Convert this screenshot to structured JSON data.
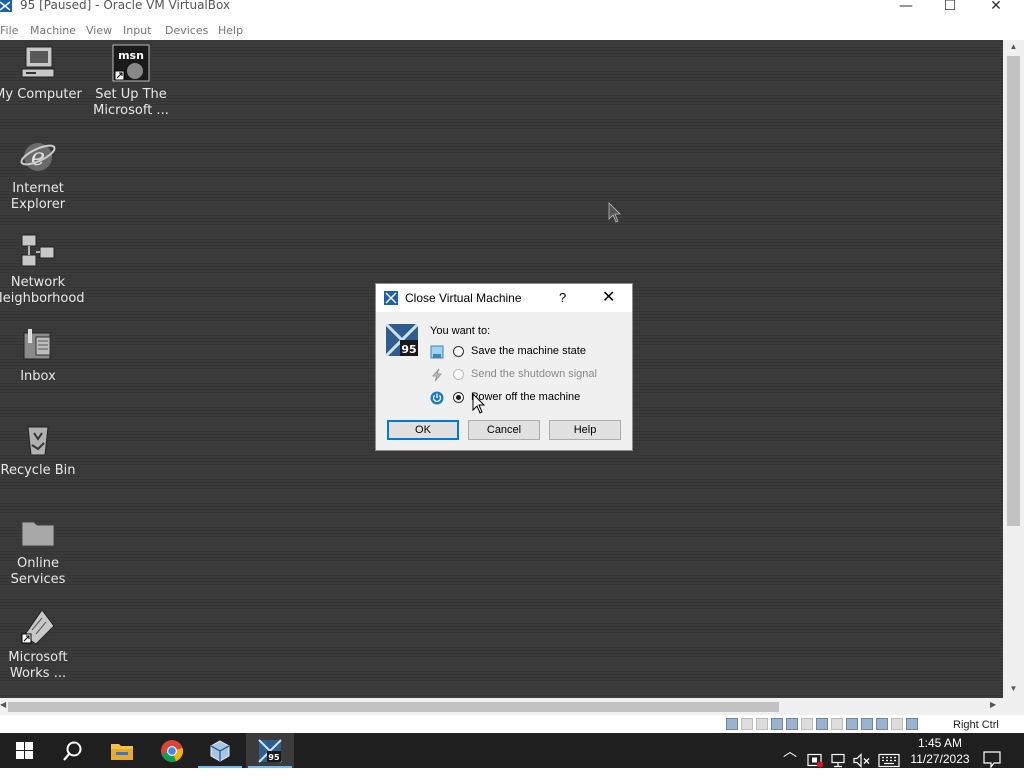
{
  "window": {
    "title": "95 [Paused] - Oracle VM VirtualBox",
    "minimize": "—",
    "maximize": "☐",
    "close": "✕"
  },
  "menu": [
    "File",
    "Machine",
    "View",
    "Input",
    "Devices",
    "Help"
  ],
  "desktop_icons": [
    {
      "line1": "My Computer",
      "line2": "",
      "icon": "computer-icon"
    },
    {
      "line1": "Set Up The",
      "line2": "Microsoft ...",
      "icon": "msn-setup-icon"
    },
    {
      "line1": "Internet",
      "line2": "Explorer",
      "icon": "internet-explorer-icon"
    },
    {
      "line1": "Network",
      "line2": "Neighborhood",
      "icon": "network-icon"
    },
    {
      "line1": "Inbox",
      "line2": "",
      "icon": "inbox-icon"
    },
    {
      "line1": "Recycle Bin",
      "line2": "",
      "icon": "recycle-bin-icon"
    },
    {
      "line1": "Online",
      "line2": "Services",
      "icon": "folder-icon"
    },
    {
      "line1": "Microsoft",
      "line2": "Works ...",
      "icon": "works-icon"
    }
  ],
  "dialog": {
    "title": "Close Virtual Machine",
    "help_glyph": "?",
    "close_glyph": "✕",
    "prompt": "You want to:",
    "options": [
      {
        "label": "Save the machine state",
        "checked": false,
        "disabled": false
      },
      {
        "label": "Send the shutdown signal",
        "checked": false,
        "disabled": true
      },
      {
        "label": "Power off the machine",
        "checked": true,
        "disabled": false
      }
    ],
    "buttons": {
      "ok": "OK",
      "cancel": "Cancel",
      "help": "Help"
    }
  },
  "statusbar": {
    "host_key": "Right Ctrl"
  },
  "taskbar": {
    "time": "1:45 AM",
    "date": "11/27/2023",
    "vm_badge": "95"
  },
  "colors": {
    "accent": "#0078d7",
    "taskbar": "#1f1f1f"
  }
}
